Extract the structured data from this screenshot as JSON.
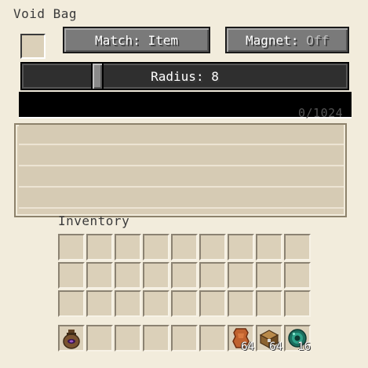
{
  "window": {
    "title": "Void Bag"
  },
  "buttons": {
    "match": {
      "prefix": "Match: ",
      "value": "Item"
    },
    "magnet": {
      "prefix": "Magnet: ",
      "value": "Off"
    }
  },
  "radius": {
    "label": "Radius: 8",
    "value": 8
  },
  "storage": {
    "count": "0/1024",
    "fill_fraction": 0
  },
  "inventory": {
    "label": "Inventory",
    "hotbar": [
      {
        "icon": "void-bag-icon",
        "count": ""
      },
      {
        "icon": "",
        "count": ""
      },
      {
        "icon": "",
        "count": ""
      },
      {
        "icon": "",
        "count": ""
      },
      {
        "icon": "",
        "count": ""
      },
      {
        "icon": "",
        "count": ""
      },
      {
        "icon": "leather-icon",
        "count": "64"
      },
      {
        "icon": "chest-icon",
        "count": "64"
      },
      {
        "icon": "ender-pearl-icon",
        "count": "16"
      }
    ]
  },
  "colors": {
    "background": "#f2ecdc",
    "slot": "#dbd0b9",
    "button": "#7a7a7a",
    "slider": "#2f2f2f"
  }
}
